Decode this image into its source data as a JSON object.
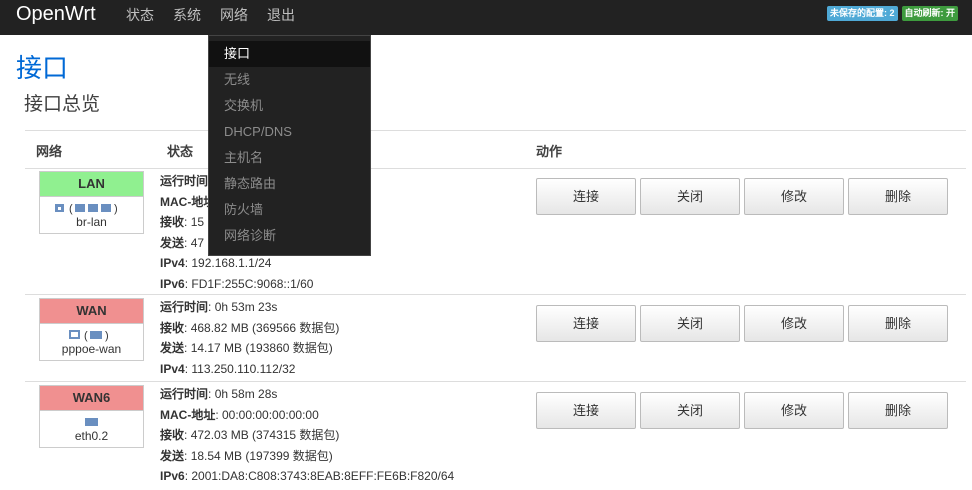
{
  "brand": "OpenWrt",
  "nav": [
    "状态",
    "系统",
    "网络",
    "退出"
  ],
  "badges": {
    "unsaved": "未保存的配置: 2",
    "autorefresh": "自动刷新: 开"
  },
  "page_title": "接口",
  "section_title": "接口总览",
  "headers": {
    "network": "网络",
    "status": "状态",
    "actions": "动作"
  },
  "buttons": {
    "connect": "连接",
    "close": "关闭",
    "edit": "修改",
    "delete": "删除"
  },
  "dropdown": [
    "接口",
    "无线",
    "交换机",
    "DHCP/DNS",
    "主机名",
    "静态路由",
    "防火墙",
    "网络诊断"
  ],
  "interfaces": [
    {
      "name": "LAN",
      "icons": "(   )",
      "device": "br-lan",
      "lines": [
        {
          "k": "运行时间",
          "v": ""
        },
        {
          "k": "MAC-地址",
          "v": ""
        },
        {
          "k": "接收",
          "v": "15"
        },
        {
          "k": "发送",
          "v": "47"
        },
        {
          "k": "IPv4",
          "v": "192.168.1.1/24"
        },
        {
          "k": "IPv6",
          "v": "FD1F:255C:9068::1/60"
        }
      ]
    },
    {
      "name": "WAN",
      "icons": "(   )",
      "device": "pppoe-wan",
      "lines": [
        {
          "k": "运行时间",
          "v": "0h 53m 23s"
        },
        {
          "k": "接收",
          "v": "468.82 MB (369566 数据包)"
        },
        {
          "k": "发送",
          "v": "14.17 MB (193860 数据包)"
        },
        {
          "k": "IPv4",
          "v": "113.250.110.112/32"
        }
      ]
    },
    {
      "name": "WAN6",
      "icons": "",
      "device": "eth0.2",
      "lines": [
        {
          "k": "运行时间",
          "v": "0h 58m 28s"
        },
        {
          "k": "MAC-地址",
          "v": "00:00:00:00:00:00"
        },
        {
          "k": "接收",
          "v": "472.03 MB (374315 数据包)"
        },
        {
          "k": "发送",
          "v": "18.54 MB (197399 数据包)"
        },
        {
          "k": "IPv6",
          "v": "2001:DA8:C808:3743:8EAB:8EFF:FE6B:F820/64"
        }
      ]
    }
  ]
}
